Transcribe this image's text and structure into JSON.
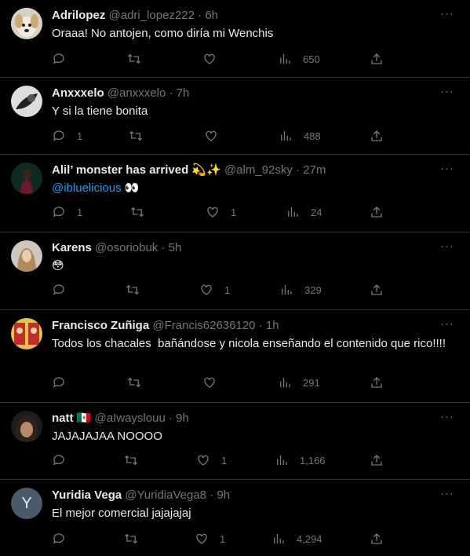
{
  "tweets": [
    {
      "name": "Adrilopez",
      "handle": "@adri_lopez222",
      "time": "6h",
      "text": "Oraaa! No antojen, como diría mi Wenchis",
      "replies": "",
      "likes": "",
      "views": "650",
      "avatar": "dog"
    },
    {
      "name": "Anxxxelo",
      "handle": "@anxxxelo",
      "time": "7h",
      "text": "Y si la tiene bonita",
      "replies": "1",
      "likes": "",
      "views": "488",
      "avatar": "bw"
    },
    {
      "name": "Alil’ monster has arrived 💫✨",
      "handle": "@alm_92sky",
      "time": "27m",
      "mention": "@ibluelicious",
      "text": " 👀",
      "replies": "1",
      "likes": "1",
      "views": "24",
      "avatar": "dark"
    },
    {
      "name": "Karens",
      "handle": "@osoriobuk",
      "time": "5h",
      "text": "😳",
      "replies": "",
      "likes": "1",
      "views": "329",
      "avatar": "girl"
    },
    {
      "name": "Francisco Zuñiga",
      "handle": "@Francis62636120",
      "time": "1h",
      "text": "Todos los chacales  bañándose y nicola enseñando el contenido que rico!!!!",
      "replies": "",
      "likes": "",
      "views": "291",
      "avatar": "red"
    },
    {
      "name": "natt 🇲🇽",
      "handle": "@aIwayslouu",
      "time": "9h",
      "text": "JAJAJAJAA NOOOO",
      "replies": "",
      "likes": "1",
      "views": "1,166",
      "avatar": "face"
    },
    {
      "name": "Yuridia Vega",
      "handle": "@YuridiaVega8",
      "time": "9h",
      "text": "El mejor comercial jajajajaj",
      "replies": "",
      "likes": "1",
      "views": "4,294",
      "avatar": "letter",
      "avatar_letter": "Y"
    }
  ],
  "icons": {
    "reply": "reply-icon",
    "retweet": "retweet-icon",
    "like": "heart-icon",
    "views": "views-icon",
    "share": "share-icon",
    "more": "more-icon"
  },
  "colors": {
    "background": "#000000",
    "text": "#e7e9ea",
    "muted": "#71767b",
    "link": "#1d9bf0",
    "divider": "#2f3336"
  },
  "more_label": "···"
}
